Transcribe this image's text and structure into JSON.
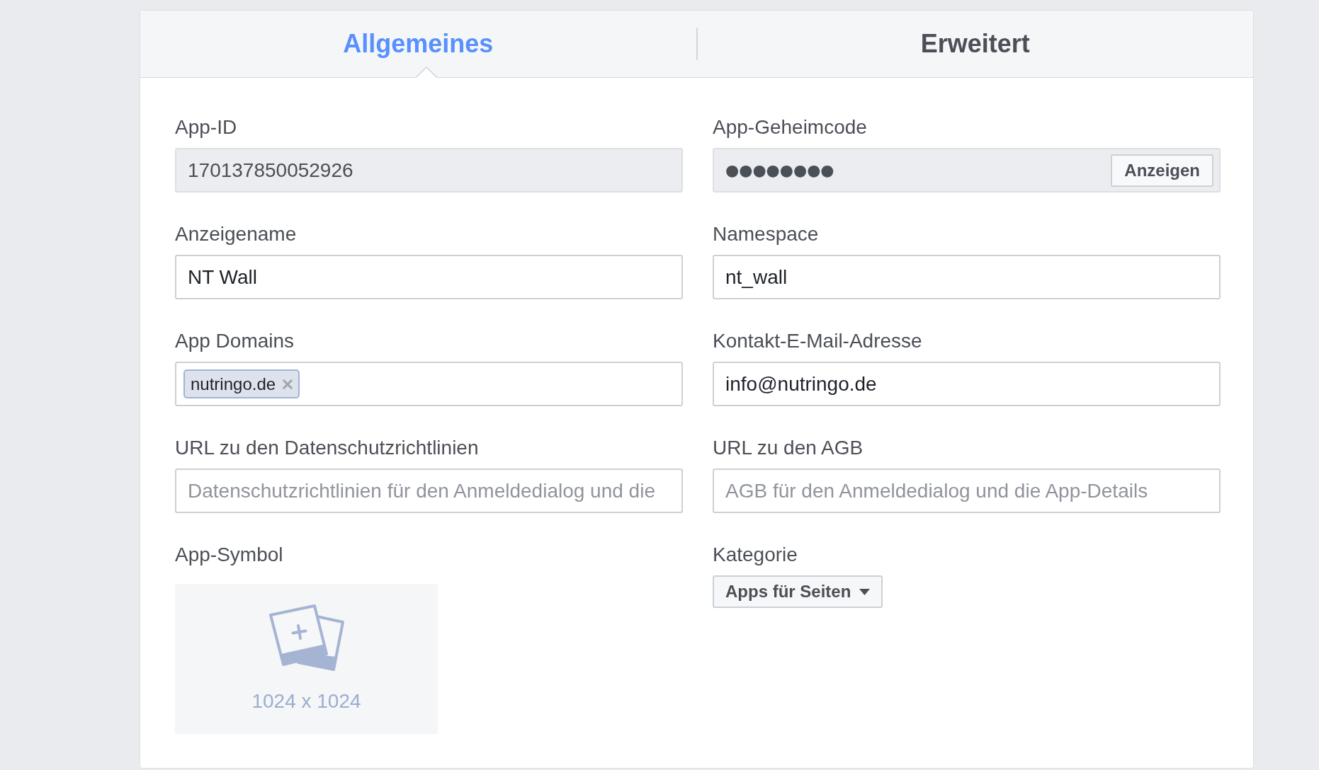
{
  "tabs": [
    {
      "label": "Allgemeines",
      "selected": true
    },
    {
      "label": "Erweitert",
      "selected": false
    }
  ],
  "fields": [
    {
      "kind": "text",
      "label": "App-ID",
      "value": "170137850052926",
      "disabled": true
    },
    {
      "kind": "secret",
      "label": "App-Geheimcode",
      "value": "●●●●●●●●",
      "button": "Anzeigen",
      "disabled": true
    },
    {
      "kind": "text",
      "label": "Anzeigename",
      "value": "NT Wall",
      "disabled": false
    },
    {
      "kind": "text",
      "label": "Namespace",
      "value": "nt_wall",
      "disabled": false
    },
    {
      "kind": "tags",
      "label": "App Domains",
      "tags": [
        "nutringo.de"
      ],
      "disabled": false
    },
    {
      "kind": "text",
      "label": "Kontakt-E-Mail-Adresse",
      "value": "info@nutringo.de",
      "disabled": false
    },
    {
      "kind": "text",
      "label": "URL zu den Datenschutzrichtlinien",
      "placeholder": "Datenschutzrichtlinien für den Anmeldedialog und die",
      "disabled": false
    },
    {
      "kind": "text",
      "label": "URL zu den AGB",
      "placeholder": "AGB für den Anmeldedialog und die App-Details",
      "disabled": false
    },
    {
      "kind": "image",
      "label": "App-Symbol",
      "size_hint": "1024 x 1024"
    },
    {
      "kind": "select",
      "label": "Kategorie",
      "value": "Apps für Seiten",
      "disabled": false
    }
  ]
}
